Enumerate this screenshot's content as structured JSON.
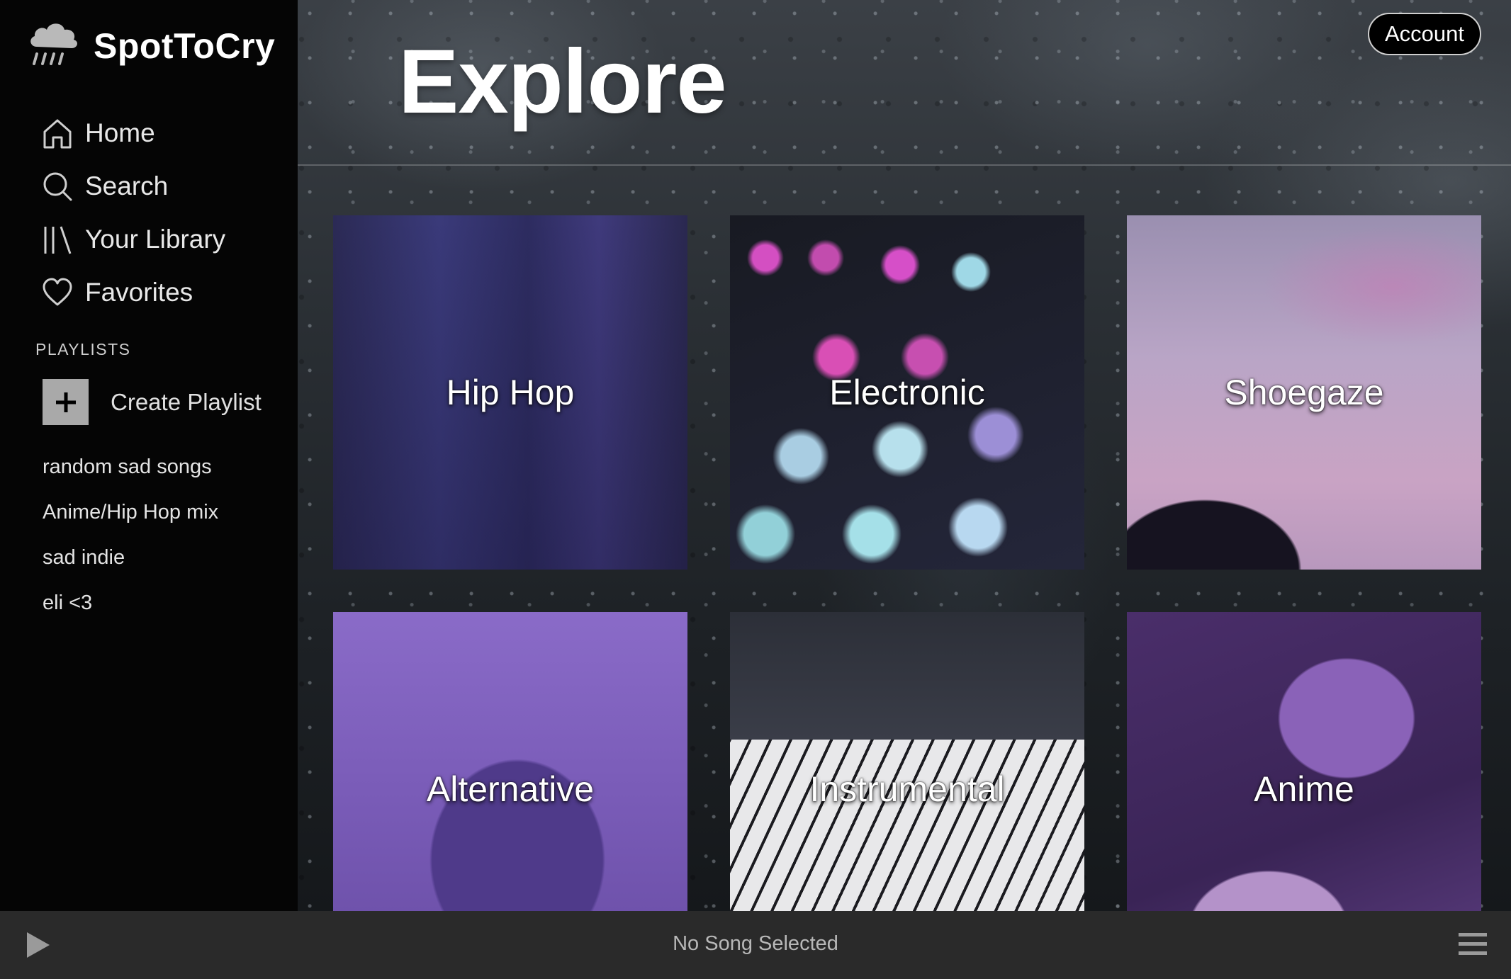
{
  "brand": {
    "name": "SpotToCry",
    "icon": "rain-cloud-icon"
  },
  "nav": [
    {
      "label": "Home",
      "icon": "home-icon"
    },
    {
      "label": "Search",
      "icon": "search-icon"
    },
    {
      "label": "Your Library",
      "icon": "library-icon"
    },
    {
      "label": "Favorites",
      "icon": "heart-icon"
    }
  ],
  "playlists": {
    "heading": "PLAYLISTS",
    "create_label": "Create Playlist",
    "items": [
      "random sad songs",
      "Anime/Hip Hop mix",
      "sad indie",
      "eli <3"
    ]
  },
  "header": {
    "title": "Explore",
    "account_label": "Account"
  },
  "genres": [
    "Hip Hop",
    "Electronic",
    "Shoegaze",
    "Alternative",
    "Instrumental",
    "Anime"
  ],
  "player": {
    "status": "No Song Selected",
    "play_icon": "play-icon",
    "queue_icon": "menu-icon"
  },
  "colors": {
    "sidebar_bg": "#050505",
    "player_bg": "#2a2a2a",
    "placeholder_box": "#a9a9a9"
  }
}
